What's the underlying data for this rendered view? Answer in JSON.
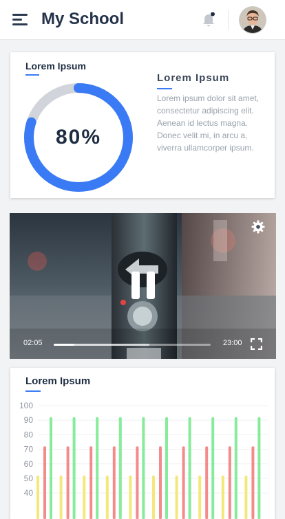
{
  "header": {
    "title": "My School",
    "icons": [
      "menu-icon",
      "bell-icon",
      "avatar"
    ],
    "notification_dot": true
  },
  "progress_card": {
    "title": "Lorem Ipsum",
    "percent_label": "80%",
    "percent_value": 0.8,
    "side_title": "Lorem Ipsum",
    "side_body": "Lorem ipsum dolor sit amet, consectetur adipiscing elit. Aenean id lectus magna. Donec velit mi,  in arcu a, viverra ullamcorper ipsum.",
    "colors": {
      "progress": "#3a7bf5",
      "track": "#d1d5db",
      "accent": "#3a7bf5"
    }
  },
  "video": {
    "current_time": "02:05",
    "duration": "23:00",
    "played_fraction": 0.13,
    "buffered_fraction": 0.61,
    "icons": [
      "gear-icon",
      "pause-icon",
      "fullscreen-icon"
    ]
  },
  "chart_card": {
    "title": "Lorem Ipsum"
  },
  "chart_data": {
    "type": "bar",
    "y_ticks": [
      "100",
      "90",
      "80",
      "70",
      "60",
      "50",
      "40"
    ],
    "ylim": [
      30,
      100
    ],
    "grid": true,
    "series": [
      {
        "color": "#f5e87a",
        "values": [
          52,
          52,
          52,
          52,
          52,
          52,
          52,
          52,
          52,
          52
        ]
      },
      {
        "color": "#f48a8a",
        "values": [
          72,
          72,
          72,
          72,
          72,
          72,
          72,
          72,
          72,
          72
        ]
      },
      {
        "color": "#86eb9a",
        "values": [
          92,
          92,
          92,
          92,
          92,
          92,
          92,
          92,
          92,
          92
        ]
      }
    ]
  }
}
